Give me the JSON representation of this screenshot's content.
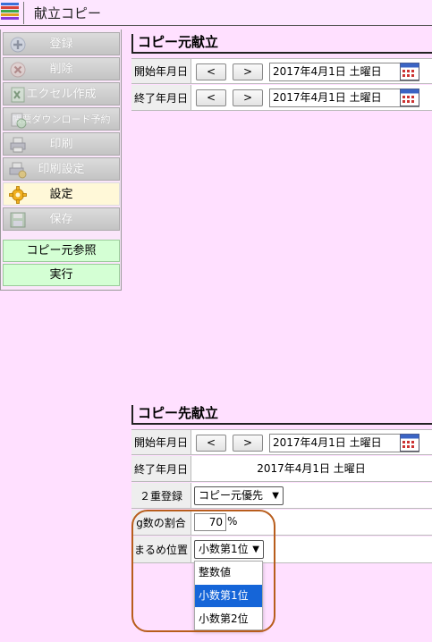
{
  "window": {
    "title": "献立コピー",
    "app_icon": "app-grid-icon"
  },
  "sidebar": {
    "items": [
      {
        "label": "登録",
        "icon": "plus-circle-icon",
        "enabled": false
      },
      {
        "label": "削除",
        "icon": "x-circle-icon",
        "enabled": false
      },
      {
        "label": "エクセル作成",
        "icon": "excel-icon",
        "enabled": false
      },
      {
        "label": "帳票ダウンロード予約",
        "icon": "download-reserve-icon",
        "enabled": false
      },
      {
        "label": "印刷",
        "icon": "printer-icon",
        "enabled": false
      },
      {
        "label": "印刷設定",
        "icon": "printer-settings-icon",
        "enabled": false
      },
      {
        "label": "設定",
        "icon": "gear-icon",
        "enabled": true
      },
      {
        "label": "保存",
        "icon": "save-icon",
        "enabled": false
      }
    ],
    "actions": [
      {
        "label": "コピー元参照"
      },
      {
        "label": "実行"
      }
    ]
  },
  "source_menu": {
    "title": "コピー元献立",
    "start_label": "開始年月日",
    "start_date": "2017年4月1日 土曜日",
    "end_label": "終了年月日",
    "end_date": "2017年4月1日 土曜日",
    "prev_label": "<",
    "next_label": ">"
  },
  "dest_menu": {
    "title": "コピー先献立",
    "start_label": "開始年月日",
    "start_date": "2017年4月1日 土曜日",
    "end_label": "終了年月日",
    "end_date": "2017年4月1日 土曜日",
    "prev_label": "<",
    "next_label": ">",
    "duplicate_label": "２重登録",
    "duplicate_value": "コピー元優先",
    "ratio_label": "g数の割合",
    "ratio_value": "70",
    "ratio_unit": "%",
    "rounding_label": "まるめ位置",
    "rounding_value": "小数第1位",
    "rounding_options": [
      "整数値",
      "小数第1位",
      "小数第2位"
    ],
    "rounding_selected_index": 1
  },
  "colors": {
    "background": "#ffe0ff",
    "active_menu": "#fff8d8",
    "action_button": "#d4ffd4",
    "selected_option": "#1565d8",
    "highlight_ring": "#b85d1c"
  }
}
